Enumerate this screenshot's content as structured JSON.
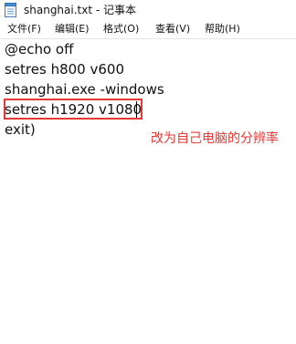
{
  "window": {
    "title": "shanghai.txt - 记事本",
    "app_icon": "notepad-icon"
  },
  "menu": {
    "items": [
      {
        "label": "文件(F)"
      },
      {
        "label": "编辑(E)"
      },
      {
        "label": "格式(O)"
      },
      {
        "label": "查看(V)"
      },
      {
        "label": "帮助(H)"
      }
    ]
  },
  "editor": {
    "lines": [
      "@echo off",
      "setres h800 v600",
      "shanghai.exe -windows",
      "setres h1920 v1080",
      "exit)"
    ]
  },
  "annotation": {
    "text": "改为自己电脑的分辨率",
    "color": "#e53935"
  }
}
